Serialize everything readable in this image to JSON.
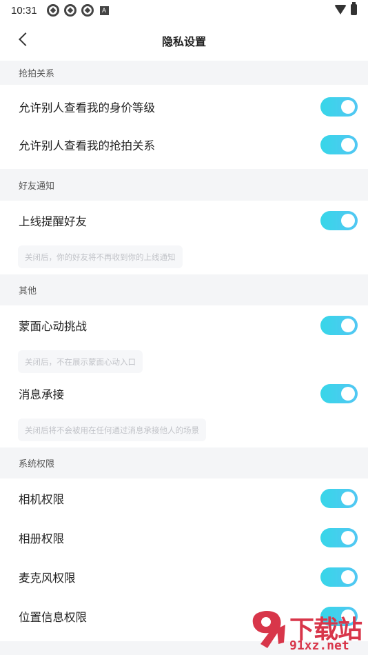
{
  "status_bar": {
    "time": "10:31",
    "badge": "A"
  },
  "header": {
    "title": "隐私设置"
  },
  "sections": [
    {
      "title": "抢拍关系",
      "rows": [
        {
          "label": "允许别人查看我的身价等级",
          "enabled": true
        },
        {
          "label": "允许别人查看我的抢拍关系",
          "enabled": true
        }
      ]
    },
    {
      "title": "好友通知",
      "rows": [
        {
          "label": "上线提醒好友",
          "enabled": true,
          "hint": "关闭后，你的好友将不再收到你的上线通知"
        }
      ]
    },
    {
      "title": "其他",
      "rows": [
        {
          "label": "蒙面心动挑战",
          "enabled": true,
          "hint": "关闭后，不在展示蒙面心动入口"
        },
        {
          "label": "消息承接",
          "enabled": true,
          "hint": "关闭后将不会被用在任何通过消息承接他人的场景"
        }
      ]
    },
    {
      "title": "系统权限",
      "rows": [
        {
          "label": "相机权限",
          "enabled": true
        },
        {
          "label": "相册权限",
          "enabled": true
        },
        {
          "label": "麦克风权限",
          "enabled": true
        },
        {
          "label": "位置信息权限",
          "enabled": true
        }
      ]
    }
  ],
  "watermark": {
    "text": "下载站",
    "url": "91xz.net"
  },
  "colors": {
    "toggle_on": "#3ad3ea",
    "background": "#f4f5f7",
    "watermark": "#d8364a"
  }
}
